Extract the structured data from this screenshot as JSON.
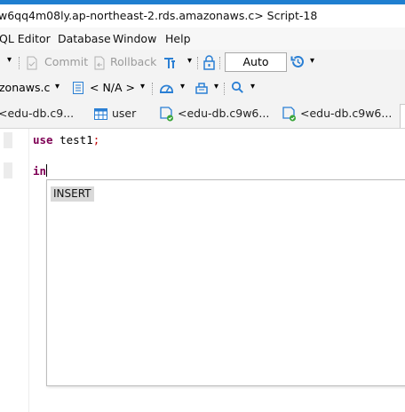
{
  "window": {
    "title": "w6qq4m08ly.ap-northeast-2.rds.amazonaws.c> Script-18"
  },
  "menu": {
    "items": [
      "QL Editor",
      "Database",
      "Window",
      "Help"
    ]
  },
  "toolbar": {
    "commit_label": "Commit",
    "rollback_label": "Rollback",
    "transaction_mode": "Auto"
  },
  "toolbar2": {
    "connection": "zonaws.c",
    "schema": "< N/A >"
  },
  "tabs": [
    {
      "label": "<edu-db.c9..."
    },
    {
      "label": "user"
    },
    {
      "label": "<edu-db.c9w6..."
    },
    {
      "label": "<edu-db.c9w6..."
    }
  ],
  "editor": {
    "line1_keyword": "use",
    "line1_ident": " test1",
    "line1_semi": ";",
    "line2_text": "in"
  },
  "autocomplete": {
    "items": [
      "INSERT"
    ]
  },
  "colors": {
    "accent": "#1f7fd0",
    "keyword": "#7f0055",
    "semicolon": "#c00000"
  }
}
